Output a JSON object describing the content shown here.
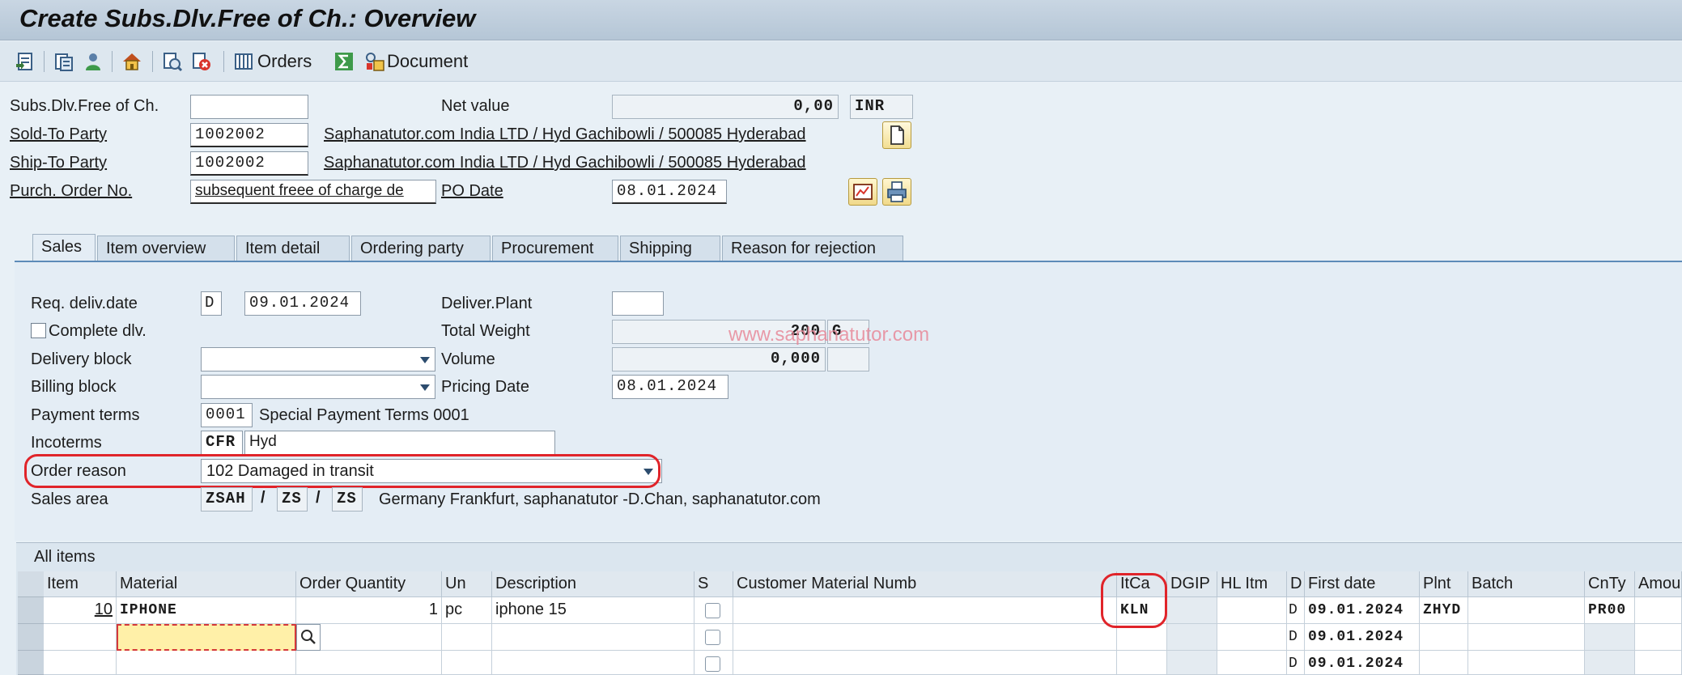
{
  "window": {
    "title": "Create Subs.Dlv.Free of Ch.: Overview"
  },
  "toolbar": {
    "orders_label": "Orders",
    "document_label": "Document"
  },
  "header": {
    "doc_label": "Subs.Dlv.Free of Ch.",
    "doc_value": "",
    "net_value_label": "Net value",
    "net_value": "0,00",
    "currency": "INR",
    "sold_to_label": "Sold-To Party",
    "sold_to_value": "1002002",
    "sold_to_desc": "Saphanatutor.com India LTD / Hyd Gachibowli / 500085 Hyderabad",
    "ship_to_label": "Ship-To Party",
    "ship_to_value": "1002002",
    "ship_to_desc": "Saphanatutor.com India LTD / Hyd Gachibowli / 500085 Hyderabad",
    "po_label": "Purch. Order No.",
    "po_value": "subsequent freee of charge de",
    "po_date_label": "PO Date",
    "po_date_value": "08.01.2024"
  },
  "tabs": [
    "Sales",
    "Item overview",
    "Item detail",
    "Ordering party",
    "Procurement",
    "Shipping",
    "Reason for rejection"
  ],
  "sales": {
    "req_deliv_label": "Req. deliv.date",
    "req_deliv_type": "D",
    "req_deliv_value": "09.01.2024",
    "deliver_plant_label": "Deliver.Plant",
    "deliver_plant_value": "",
    "complete_dlv_label": "Complete dlv.",
    "total_weight_label": "Total Weight",
    "total_weight_value": "200",
    "weight_unit": "G",
    "delivery_block_label": "Delivery block",
    "delivery_block_value": "",
    "volume_label": "Volume",
    "volume_value": "0,000",
    "volume_unit": "",
    "billing_block_label": "Billing block",
    "billing_block_value": "",
    "pricing_date_label": "Pricing Date",
    "pricing_date_value": "08.01.2024",
    "payment_terms_label": "Payment terms",
    "payment_terms_code": "0001",
    "payment_terms_desc": "Special Payment Terms 0001",
    "incoterms_label": "Incoterms",
    "incoterms_code": "CFR",
    "incoterms_place": "Hyd",
    "order_reason_label": "Order reason",
    "order_reason_value": "102 Damaged in transit",
    "sales_area_label": "Sales area",
    "sales_org": "ZSAH",
    "dist_channel": "ZS",
    "division": "ZS",
    "sales_area_desc": "Germany Frankfurt, saphanatutor -D.Chan, saphanatutor.com",
    "sep1": "/",
    "sep2": "/",
    "watermark": "www.saphanatutor.com"
  },
  "items": {
    "title": "All items",
    "columns": [
      "Item",
      "Material",
      "Order Quantity",
      "Un",
      "Description",
      "S",
      "Customer Material Numb",
      "ItCa",
      "DGIP",
      "HL Itm",
      "D",
      "First date",
      "Plnt",
      "Batch",
      "CnTy",
      "Amou"
    ],
    "rows": [
      {
        "item": "10",
        "material": "IPHONE",
        "qty": "1",
        "un": "pc",
        "desc": "iphone 15",
        "itca": "KLN",
        "d": "D",
        "first_date": "09.01.2024",
        "plnt": "ZHYD",
        "cnty": "PR00"
      },
      {
        "item": "",
        "material": "",
        "qty": "",
        "un": "",
        "desc": "",
        "itca": "",
        "d": "D",
        "first_date": "09.01.2024",
        "plnt": "",
        "cnty": ""
      },
      {
        "item": "",
        "material": "",
        "qty": "",
        "un": "",
        "desc": "",
        "itca": "",
        "d": "D",
        "first_date": "09.01.2024",
        "plnt": "",
        "cnty": ""
      }
    ]
  }
}
